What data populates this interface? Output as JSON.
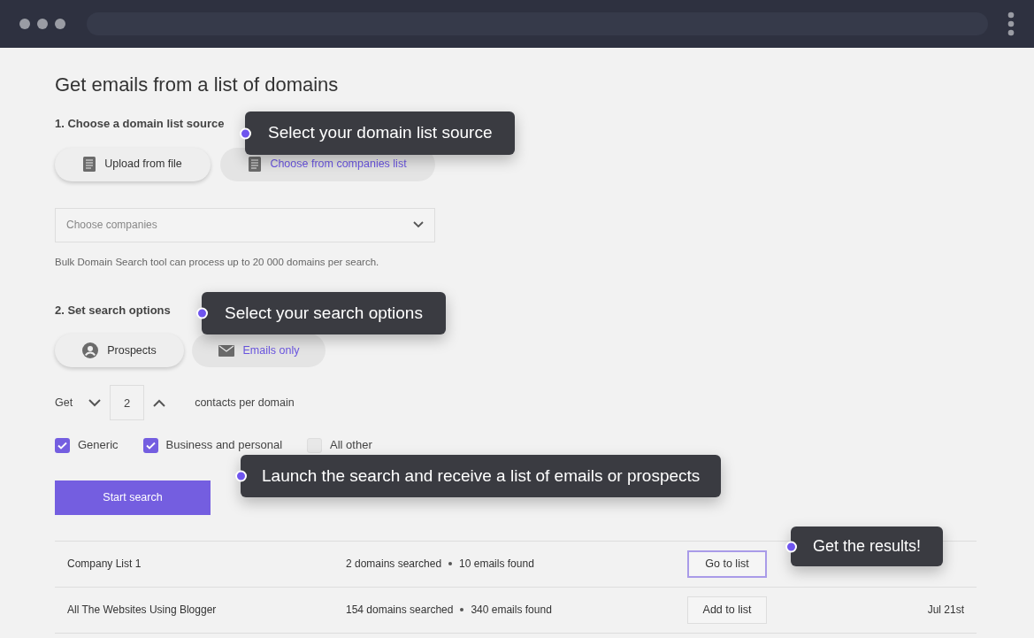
{
  "title": "Get emails from a list of domains",
  "source_section": {
    "label": "1. Choose a domain list source",
    "options": [
      {
        "label": "Upload from file",
        "selected": false
      },
      {
        "label": "Choose from companies list",
        "selected": true
      }
    ],
    "dropdown": {
      "placeholder": "Choose companies"
    },
    "note": "Bulk Domain Search tool can process up to 20 000 domains per search."
  },
  "options_section": {
    "label": "2. Set search options",
    "modes": [
      {
        "label": "Prospects",
        "selected": false
      },
      {
        "label": "Emails only",
        "selected": true
      }
    ],
    "count": {
      "prefix": "Get",
      "value": "2",
      "suffix": "contacts per domain"
    },
    "filters": [
      {
        "label": "Generic",
        "checked": true
      },
      {
        "label": "Business and personal",
        "checked": true
      },
      {
        "label": "All other",
        "checked": false
      }
    ]
  },
  "start_button": "Start search",
  "results": [
    {
      "name": "Company List 1",
      "domains": "2 domains searched",
      "emails": "10 emails found",
      "action": "Go to list",
      "highlighted": true
    },
    {
      "name": "All The Websites Using Blogger",
      "domains": "154 domains searched",
      "emails": "340 emails found",
      "action": "Add to list",
      "highlighted": false,
      "date": "Jul 21st"
    }
  ],
  "tooltips": [
    {
      "text": "Select your domain list source"
    },
    {
      "text": "Select your search options"
    },
    {
      "text": "Launch the search and receive a list of emails or prospects"
    },
    {
      "text": "Get the results!"
    }
  ]
}
